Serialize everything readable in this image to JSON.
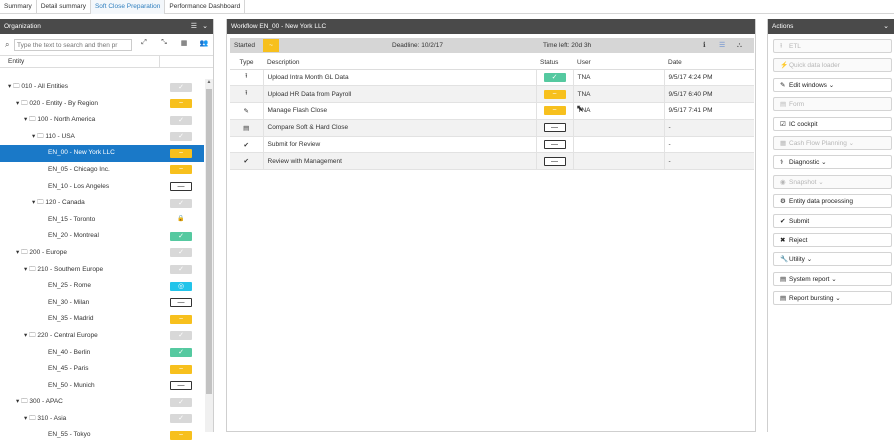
{
  "tabs": [
    "Summary",
    "Detail summary",
    "Soft Close Preparation",
    "Performance Dashboard"
  ],
  "active_tab_index": 2,
  "organization": {
    "title": "Organization",
    "search_placeholder": "Type the text to search and then pr",
    "column_header": "Entity",
    "rows": [
      {
        "level": 0,
        "expander": "▾",
        "folder": true,
        "label": "010 - All Entities",
        "status": "gray"
      },
      {
        "level": 1,
        "expander": "▾",
        "folder": true,
        "label": "020 - Entity - By Region",
        "status": "yellow"
      },
      {
        "level": 2,
        "expander": "▾",
        "folder": true,
        "label": "100 - North America",
        "status": "gray"
      },
      {
        "level": 3,
        "expander": "▾",
        "folder": true,
        "label": "110 - USA",
        "status": "gray"
      },
      {
        "level": 4,
        "expander": "",
        "folder": false,
        "label": "EN_00 - New York LLC",
        "status": "yellow",
        "selected": true
      },
      {
        "level": 4,
        "expander": "",
        "folder": false,
        "label": "EN_05 - Chicago Inc.",
        "status": "yellow"
      },
      {
        "level": 4,
        "expander": "",
        "folder": false,
        "label": "EN_10 - Los Angeles",
        "status": "empty"
      },
      {
        "level": 3,
        "expander": "▾",
        "folder": true,
        "label": "120 - Canada",
        "status": "gray"
      },
      {
        "level": 4,
        "expander": "",
        "folder": false,
        "label": "EN_15 - Toronto",
        "status": "lock"
      },
      {
        "level": 4,
        "expander": "",
        "folder": false,
        "label": "EN_20 - Montreal",
        "status": "green"
      },
      {
        "level": 1,
        "expander": "▾",
        "folder": true,
        "label": "200 - Europe",
        "status": "gray"
      },
      {
        "level": 2,
        "expander": "▾",
        "folder": true,
        "label": "210 - Southern Europe",
        "status": "gray"
      },
      {
        "level": 4,
        "expander": "",
        "folder": false,
        "label": "EN_25 - Rome",
        "status": "cyan"
      },
      {
        "level": 4,
        "expander": "",
        "folder": false,
        "label": "EN_30 - Milan",
        "status": "empty"
      },
      {
        "level": 4,
        "expander": "",
        "folder": false,
        "label": "EN_35 - Madrid",
        "status": "yellow"
      },
      {
        "level": 2,
        "expander": "▾",
        "folder": true,
        "label": "220 - Central Europe",
        "status": "gray"
      },
      {
        "level": 4,
        "expander": "",
        "folder": false,
        "label": "EN_40 - Berlin",
        "status": "green"
      },
      {
        "level": 4,
        "expander": "",
        "folder": false,
        "label": "EN_45 - Paris",
        "status": "yellow"
      },
      {
        "level": 4,
        "expander": "",
        "folder": false,
        "label": "EN_50 - Munich",
        "status": "empty"
      },
      {
        "level": 1,
        "expander": "▾",
        "folder": true,
        "label": "300 - APAC",
        "status": "gray"
      },
      {
        "level": 2,
        "expander": "▾",
        "folder": true,
        "label": "310 - Asia",
        "status": "gray"
      },
      {
        "level": 4,
        "expander": "",
        "folder": false,
        "label": "EN_55 - Tokyo",
        "status": "yellow"
      }
    ]
  },
  "workflow": {
    "title": "Workflow EN_00 - New York LLC",
    "started_label": "Started",
    "deadline": "Deadline: 10/2/17",
    "time_left": "Time left: 20d 3h",
    "columns": {
      "type": "Type",
      "description": "Description",
      "status": "Status",
      "user": "User",
      "date": "Date"
    },
    "rows": [
      {
        "type_icon": "upload-icon",
        "description": "Upload Intra Month GL Data",
        "status": "green",
        "user": "TNA",
        "date": "9/5/17 4:24 PM"
      },
      {
        "type_icon": "upload-icon",
        "description": "Upload HR Data from Payroll",
        "status": "yellow",
        "user": "TNA",
        "date": "9/5/17 6:40 PM"
      },
      {
        "type_icon": "edit-icon",
        "description": "Manage Flash Close",
        "status": "yellow",
        "user": "TNA",
        "date": "9/5/17 7:41 PM"
      },
      {
        "type_icon": "document-icon",
        "description": "Compare Soft & Hard Close",
        "status": "empty",
        "user": "",
        "date": "-"
      },
      {
        "type_icon": "check-icon",
        "description": "Submit for Review",
        "status": "empty",
        "user": "",
        "date": "-"
      },
      {
        "type_icon": "check-icon",
        "description": "Review with Management",
        "status": "empty",
        "user": "",
        "date": "-"
      }
    ]
  },
  "actions": {
    "title": "Actions",
    "buttons": [
      {
        "icon": "upload-icon",
        "label": "ETL",
        "enabled": false
      },
      {
        "icon": "bolt-icon",
        "label": "Quick data loader",
        "enabled": false
      },
      {
        "icon": "edit-icon",
        "label": "Edit windows ⌄",
        "enabled": true
      },
      {
        "icon": "document-icon",
        "label": "Form",
        "enabled": false
      },
      {
        "icon": "checkbox-icon",
        "label": "IC cockpit",
        "enabled": true
      },
      {
        "icon": "calculator-icon",
        "label": "Cash Flow Planning ⌄",
        "enabled": false
      },
      {
        "icon": "stethoscope-icon",
        "label": "Diagnostic ⌄",
        "enabled": true
      },
      {
        "icon": "camera-icon",
        "label": "Snapshot ⌄",
        "enabled": false
      },
      {
        "icon": "gears-icon",
        "label": "Entity data processing",
        "enabled": true
      },
      {
        "icon": "check-icon",
        "label": "Submit",
        "enabled": true
      },
      {
        "icon": "close-icon",
        "label": "Reject",
        "enabled": true
      },
      {
        "icon": "wrench-icon",
        "label": "Utility ⌄",
        "enabled": true
      },
      {
        "icon": "report-icon",
        "label": "System report ⌄",
        "enabled": true
      },
      {
        "icon": "report-icon",
        "label": "Report bursting ⌄",
        "enabled": true
      }
    ]
  },
  "colors": {
    "header_bg": "#4a4a4a",
    "selected_row": "#1a79c8",
    "status_yellow": "#f7c01d",
    "status_green": "#55c9a0",
    "status_cyan": "#22c4ea",
    "status_gray": "#d8d8d8",
    "active_tab_text": "#2f7fbf"
  }
}
